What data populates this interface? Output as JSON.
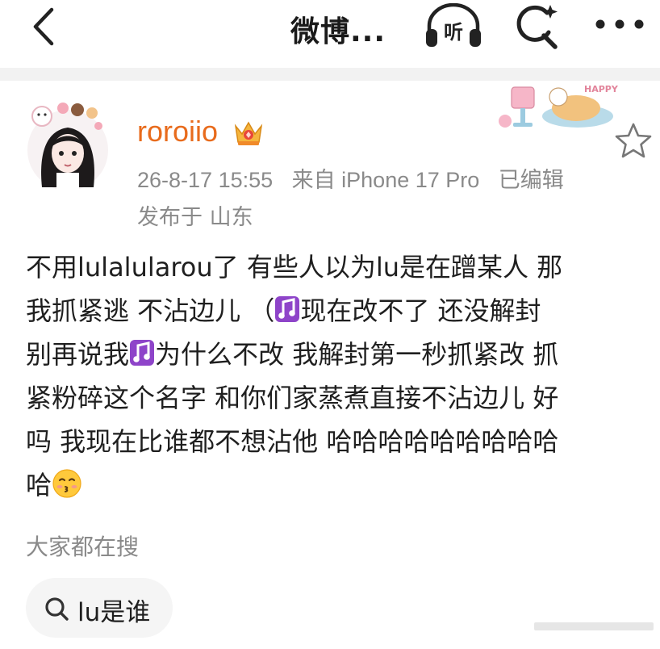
{
  "nav": {
    "title": "微博...",
    "listen_label": "听"
  },
  "post": {
    "author": {
      "username": "roroiio"
    },
    "meta": {
      "date": "26-8-17 15:55",
      "source": "来自 iPhone 17 Pro",
      "edited": "已编辑",
      "location": "发布于 山东"
    },
    "body_lines": [
      "不用lulalularou了 有些人以为lu是在蹭某人 那",
      "我抓紧逃 不沾边儿 （",
      "现在改不了 还没解封",
      "别再说我",
      "为什么不改 我解封第一秒抓紧改 抓",
      "紧粉碎这个名字 和你们家蒸煮直接不沾边儿 好",
      "吗 我现在比谁都不想沾他 哈哈哈哈哈哈哈哈哈",
      "哈"
    ]
  },
  "suggestions": {
    "title": "大家都在搜",
    "items": [
      {
        "label": "lu是谁"
      }
    ]
  },
  "colors": {
    "username": "#e86b1c",
    "meta": "#8a8a8a",
    "note_emoji": "#8e44c9",
    "chip_bg": "#f5f5f5"
  },
  "icons": {
    "back": "chevron-left-icon",
    "listen": "headphones-icon",
    "search": "search-ai-icon",
    "more": "more-dots-icon",
    "badge": "crown-icon",
    "favorite": "star-icon",
    "note": "music-note-emoji",
    "face": "kissing-face-emoji"
  }
}
